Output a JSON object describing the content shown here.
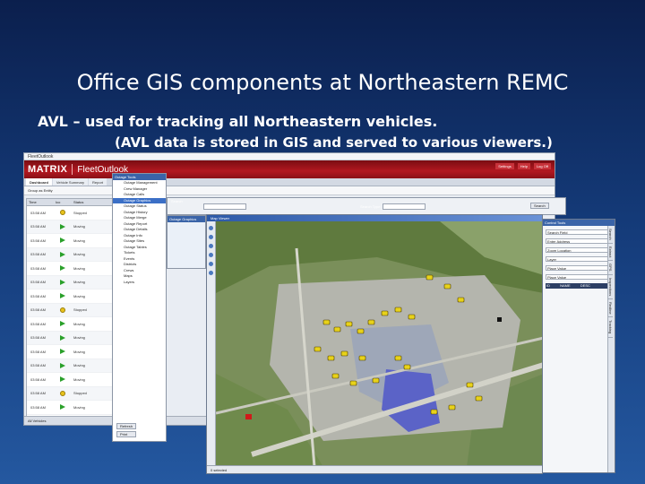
{
  "slide": {
    "title": "Office GIS components at Northeastern REMC",
    "bullet_main": "AVL – used for tracking all Northeastern vehicles.",
    "bullet_sub": "(AVL data is stored in GIS and served to various viewers.)"
  },
  "fleet": {
    "topbar": "FleetOutlook",
    "brand_matrix": "MATRIX",
    "brand_fleet": "FleetOutlook",
    "header_links": [
      "Settings",
      "Help",
      "Log Off"
    ],
    "tabs": [
      "Dashboard",
      "Vehicle Summary",
      "Report"
    ],
    "filter": "Group as Entity",
    "table_headers": [
      "Time",
      "Ico",
      "Status"
    ],
    "rows": [
      {
        "time": "03:58 AM",
        "icon": "dot",
        "status": "Stopped"
      },
      {
        "time": "03:58 AM",
        "icon": "arrow",
        "status": "Moving"
      },
      {
        "time": "03:58 AM",
        "icon": "arrow",
        "status": "Moving"
      },
      {
        "time": "03:58 AM",
        "icon": "arrow",
        "status": "Moving"
      },
      {
        "time": "03:58 AM",
        "icon": "arrow",
        "status": "Moving"
      },
      {
        "time": "03:58 AM",
        "icon": "arrow",
        "status": "Moving"
      },
      {
        "time": "03:58 AM",
        "icon": "arrow",
        "status": "Moving"
      },
      {
        "time": "03:58 AM",
        "icon": "dot",
        "status": "Stopped"
      },
      {
        "time": "03:58 AM",
        "icon": "arrow",
        "status": "Moving"
      },
      {
        "time": "03:58 AM",
        "icon": "arrow",
        "status": "Moving"
      },
      {
        "time": "03:58 AM",
        "icon": "arrow",
        "status": "Moving"
      },
      {
        "time": "03:58 AM",
        "icon": "arrow",
        "status": "Moving"
      },
      {
        "time": "03:58 AM",
        "icon": "arrow",
        "status": "Moving"
      },
      {
        "time": "03:58 AM",
        "icon": "dot",
        "status": "Stopped"
      },
      {
        "time": "03:58 AM",
        "icon": "arrow",
        "status": "Moving"
      }
    ],
    "footer": "All Vehicles"
  },
  "outage": {
    "title": "Outage Tools",
    "items": [
      "Outage Management",
      "Crew Manager",
      "Outage Calls",
      "Outage Graphics",
      "Outage Status",
      "Outage History",
      "Outage Merge",
      "Outage Report",
      "Outage Details",
      "Outage Info",
      "Outage Sites",
      "Outage Tables",
      "Tickets",
      "Events",
      "Districts",
      "Crews",
      "Maps",
      "Layers"
    ],
    "selected_index": 3,
    "buttons": [
      "Refresh",
      "Print"
    ]
  },
  "gis_toolbar": {
    "title": "Search",
    "search_placeholder": "",
    "search_type_label": "Search Type:",
    "search_button": "Search"
  },
  "outage_graphics": {
    "title": "Outage Graphics"
  },
  "map": {
    "title": "Map Viewer",
    "status": "0 selected"
  },
  "control_panel": {
    "title": "Control Tools",
    "fields": [
      "Search Field",
      "Enter Address",
      "Zoom Location",
      "Layer",
      "Place Value",
      "Place Value"
    ],
    "grid_headers": [
      "ID",
      "NAME",
      "DESC"
    ],
    "vtabs": [
      "Search",
      "Extract",
      "GPS",
      "Inspections",
      "Redline",
      "Tracking"
    ]
  },
  "colors": {
    "slide_bg": "#143a78",
    "header_red": "#b31820",
    "accent_blue": "#3a64a8"
  }
}
